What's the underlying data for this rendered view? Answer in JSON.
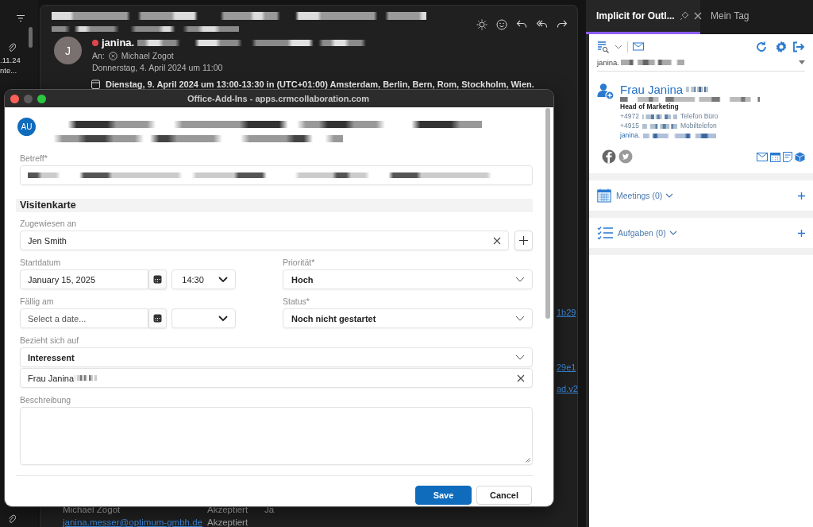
{
  "mail_list": {
    "items": [
      {
        "date": ".11.24",
        "preview": "nte..."
      }
    ]
  },
  "reading_pane": {
    "sender": {
      "initial": "J",
      "name": "janina."
    },
    "to_label": "An:",
    "recipient": "Michael Zogot",
    "sent": "Donnerstag, 4. April 2024 um 11:00",
    "meeting": "Dienstag, 9. April 2024 um 13:00-13:30 in (UTC+01:00) Amsterdam, Berlin, Bern, Rom, Stockholm, Wien.",
    "link_fragments": [
      "1b29",
      "29e1",
      "ad.v2"
    ],
    "attendees": [
      {
        "name": "Michael Zogot",
        "response": "Akzeptiert",
        "column_3": "Ja"
      },
      {
        "name": "janina.messer@optimum-gmbh.de",
        "response": "Akzeptiert"
      }
    ]
  },
  "dialog": {
    "title": "Office-Add-Ins - apps.crmcollaboration.com",
    "avatar": "AU",
    "subject_label": "Betreff*",
    "section": "Visitenkarte",
    "assigned": {
      "label": "Zugewiesen an",
      "value": "Jen Smith"
    },
    "start": {
      "label": "Startdatum",
      "date": "January 15, 2025",
      "time": "14:30"
    },
    "due": {
      "label": "Fällig am",
      "placeholder": "Select a date..."
    },
    "priority": {
      "label": "Priorität*",
      "value": "Hoch"
    },
    "status": {
      "label": "Status*",
      "value": "Noch nicht gestartet"
    },
    "related": {
      "label": "Bezieht sich auf",
      "type": "Interessent",
      "record": "Frau Janina"
    },
    "description": {
      "label": "Beschreibung"
    },
    "buttons": [
      {
        "label": "Save",
        "kind": "primary"
      },
      {
        "label": "Cancel",
        "kind": "secondary"
      }
    ]
  },
  "addin": {
    "tabs": [
      {
        "label": "Implicit for Outl...",
        "selected": true
      },
      {
        "label": "Mein Tag",
        "selected": false
      }
    ],
    "account": "janina.",
    "contact": {
      "name": "Frau Janina",
      "title": "Head of Marketing",
      "phones": [
        {
          "number": "+4972",
          "type": "Telefon Büro"
        },
        {
          "number": "+4915",
          "type": "Mobiltelefon"
        }
      ],
      "email": "janina."
    },
    "sections": [
      {
        "label": "Meetings (0)",
        "kind": "meetings"
      },
      {
        "label": "Aufgaben (0)",
        "kind": "tasks"
      }
    ]
  }
}
